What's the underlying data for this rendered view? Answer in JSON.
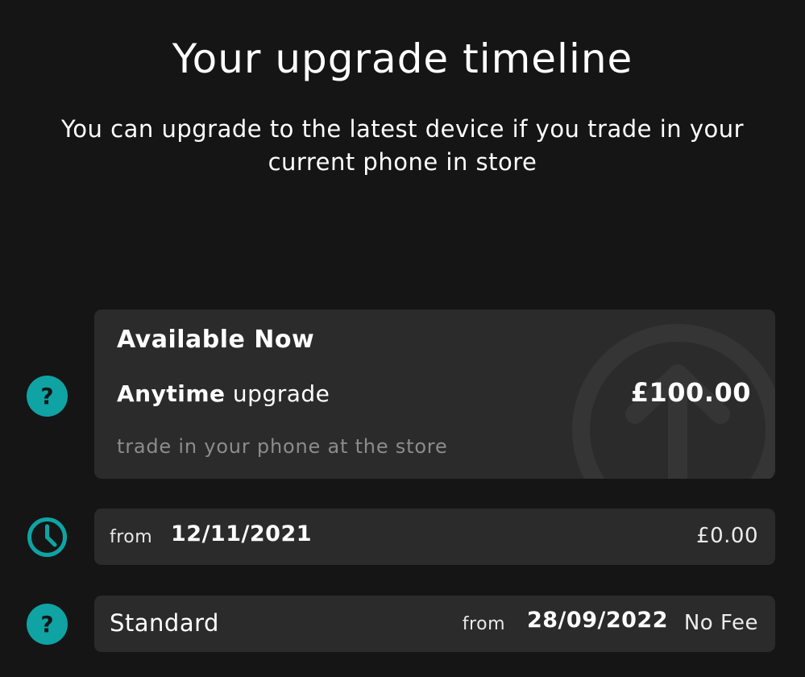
{
  "header": {
    "title": "Your upgrade timeline",
    "subtitle": "You can upgrade to the latest device if you trade in your current phone in store"
  },
  "available_card": {
    "heading": "Available Now",
    "plan_name": "Anytime",
    "plan_suffix": "upgrade",
    "price": "£100.00",
    "note": "trade in your phone at the store",
    "icon": "help-icon"
  },
  "date_card": {
    "from_label": "from",
    "date": "12/11/2021",
    "fee": "£0.00",
    "icon": "clock-icon"
  },
  "standard_card": {
    "label": "Standard",
    "from_label": "from",
    "date": "28/09/2022",
    "fee": "No Fee",
    "icon": "help-icon"
  },
  "colors": {
    "background": "#151515",
    "card": "#2b2b2b",
    "accent": "#0fa3a3",
    "muted_text": "#8c8c8c"
  }
}
